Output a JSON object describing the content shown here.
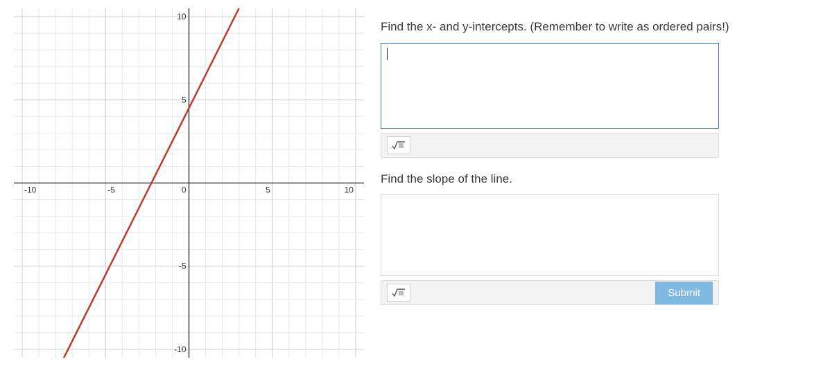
{
  "chart_data": {
    "type": "line",
    "title": "",
    "xlabel": "",
    "ylabel": "",
    "xlim": [
      -10.5,
      10.5
    ],
    "ylim": [
      -10.5,
      10.5
    ],
    "x_ticks": [
      -10,
      -5,
      0,
      5,
      10
    ],
    "y_ticks": [
      -10,
      -5,
      5,
      10
    ],
    "grid": true,
    "series": [
      {
        "name": "line",
        "color": "#c0392b",
        "points": [
          [
            -7.5,
            -10.5
          ],
          [
            3,
            10.5
          ]
        ]
      }
    ],
    "line_equation": "y = 2x + 5",
    "x_intercept": [
      -2.5,
      0
    ],
    "y_intercept": [
      0,
      5
    ],
    "slope": 2
  },
  "question1": {
    "prompt": "Find the x- and y-intercepts. (Remember to write as ordered pairs!)",
    "answer_value": ""
  },
  "question2": {
    "prompt": "Find the slope of the line.",
    "answer_value": ""
  },
  "buttons": {
    "submit": "Submit"
  },
  "icons": {
    "math_sqrt": "√"
  }
}
